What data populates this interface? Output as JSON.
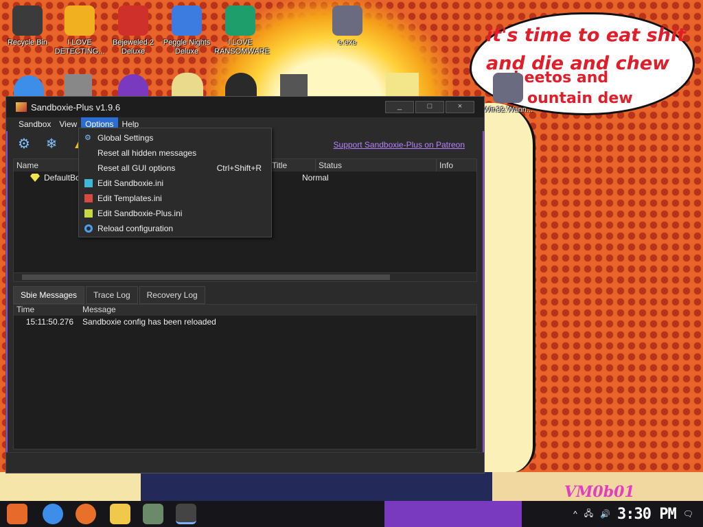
{
  "desktop": {
    "icons": [
      {
        "label": "Recycle Bin",
        "color": "#3b3b3b"
      },
      {
        "label": "I LOVE DETECTING...",
        "color": "#f0b020"
      },
      {
        "label": "Bejeweled 2 Deluxe",
        "color": "#d0302a"
      },
      {
        "label": "Peggle Nights Deluxe",
        "color": "#3c7be0"
      },
      {
        "label": "I LOVE RANSOMWARE",
        "color": "#1e9e6a"
      },
      {
        "label": "e.exe",
        "color": "#6a6a80"
      },
      {
        "label": "Win32.Wann...",
        "color": "#6a6a80"
      }
    ],
    "speech_bubble": {
      "line1": "it's time to eat shit",
      "line2": "and die and chew",
      "line3": "heetos and",
      "line4": "ountain dew"
    },
    "watermark": "VM0b01"
  },
  "window": {
    "title": "Sandboxie-Plus v1.9.6",
    "buttons": [
      "_",
      "□",
      "×"
    ],
    "menu": [
      "Sandbox",
      "View",
      "Options",
      "Help"
    ],
    "active_menu": "Options",
    "patreon_link": "Support Sandboxie-Plus on Patreon",
    "tree": {
      "columns": [
        "Name",
        "Title",
        "Status",
        "Info"
      ],
      "rows": [
        {
          "name": "DefaultBox",
          "status": "Normal"
        }
      ]
    },
    "tabs": [
      "Sbie Messages",
      "Trace Log",
      "Recovery Log"
    ],
    "log": {
      "columns": [
        "Time",
        "Message"
      ],
      "rows": [
        {
          "time": "15:11:50.276",
          "message": "Sandboxie config has been reloaded"
        }
      ]
    }
  },
  "options_menu": [
    {
      "label": "Global Settings",
      "icon": "gears-icon",
      "shortcut": ""
    },
    {
      "label": "Reset all hidden messages",
      "icon": "",
      "shortcut": ""
    },
    {
      "label": "Reset all GUI options",
      "icon": "",
      "shortcut": "Ctrl+Shift+R"
    },
    {
      "label": "Edit Sandboxie.ini",
      "icon": "ini-file-icon",
      "shortcut": ""
    },
    {
      "label": "Edit Templates.ini",
      "icon": "ini-file-icon",
      "shortcut": ""
    },
    {
      "label": "Edit Sandboxie-Plus.ini",
      "icon": "ini-file-icon",
      "shortcut": ""
    },
    {
      "label": "Reload configuration",
      "icon": "reload-icon",
      "shortcut": ""
    }
  ],
  "taskbar": {
    "clock": "3:30 PM"
  },
  "colors": {
    "accent": "#2c6dd1",
    "patreon": "#b780ff",
    "speech_text": "#e11d2a"
  }
}
